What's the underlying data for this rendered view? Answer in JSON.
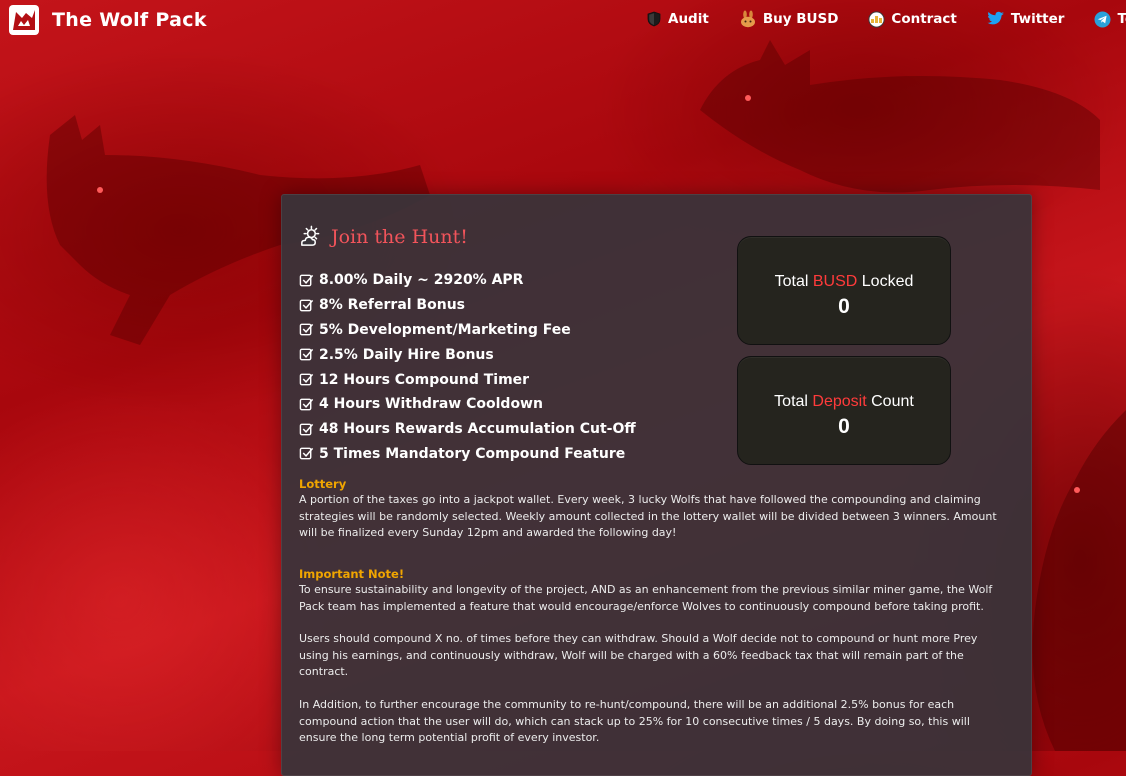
{
  "navbar": {
    "title": "The Wolf Pack",
    "links": [
      {
        "label": "Audit",
        "icon": "shield-icon"
      },
      {
        "label": "Buy BUSD",
        "icon": "bunny-icon"
      },
      {
        "label": "Contract",
        "icon": "contract-icon"
      },
      {
        "label": "Twitter",
        "icon": "twitter-icon"
      },
      {
        "label": "Tel",
        "icon": "telegram-icon"
      }
    ]
  },
  "hunt": {
    "title": "Join the Hunt!",
    "features": [
      "8.00% Daily ~ 2920% APR",
      "8% Referral Bonus",
      "5% Development/Marketing Fee",
      "2.5% Daily Hire Bonus",
      "12 Hours Compound Timer",
      "4 Hours Withdraw Cooldown",
      "48 Hours Rewards Accumulation Cut-Off",
      "5 Times Mandatory Compound Feature"
    ]
  },
  "stats": {
    "locked": {
      "prefix": "Total ",
      "highlight": "BUSD",
      "suffix": " Locked",
      "value": "0"
    },
    "deposits": {
      "prefix": "Total ",
      "highlight": "Deposit",
      "suffix": " Count",
      "value": "0"
    }
  },
  "lottery": {
    "title": "Lottery",
    "text": "A portion of the taxes go into a jackpot wallet. Every week, 3 lucky Wolfs that have followed the compounding and claiming strategies will be randomly selected. Weekly amount collected in the lottery wallet will be divided between 3 winners. Amount will be finalized every Sunday 12pm and awarded the following day!"
  },
  "important": {
    "title": "Important Note!",
    "p1": "To ensure sustainability and longevity of the project, AND as an enhancement from the previous similar miner game, the Wolf Pack team has implemented a feature that would encourage/enforce Wolves to continuously compound before taking profit.",
    "p2": "Users should compound X no. of times before they can withdraw. Should a Wolf decide not to compound or hunt more Prey using his earnings, and continuously withdraw, Wolf will be charged with a 60% feedback tax that will remain part of the contract.",
    "p3": "In Addition, to further encourage the community to re-hunt/compound, there will be an additional 2.5% bonus for each compound action that the user will do, which can stack up to 25% for 10 consecutive times / 5 days. By doing so, this will ensure the long term potential profit of every investor."
  },
  "colors": {
    "accent_red": "#f2545b",
    "highlight_red": "#ff3b3b",
    "section_orange": "#f0a500",
    "card_bg": "#38343a",
    "stat_bg": "#25241e"
  }
}
